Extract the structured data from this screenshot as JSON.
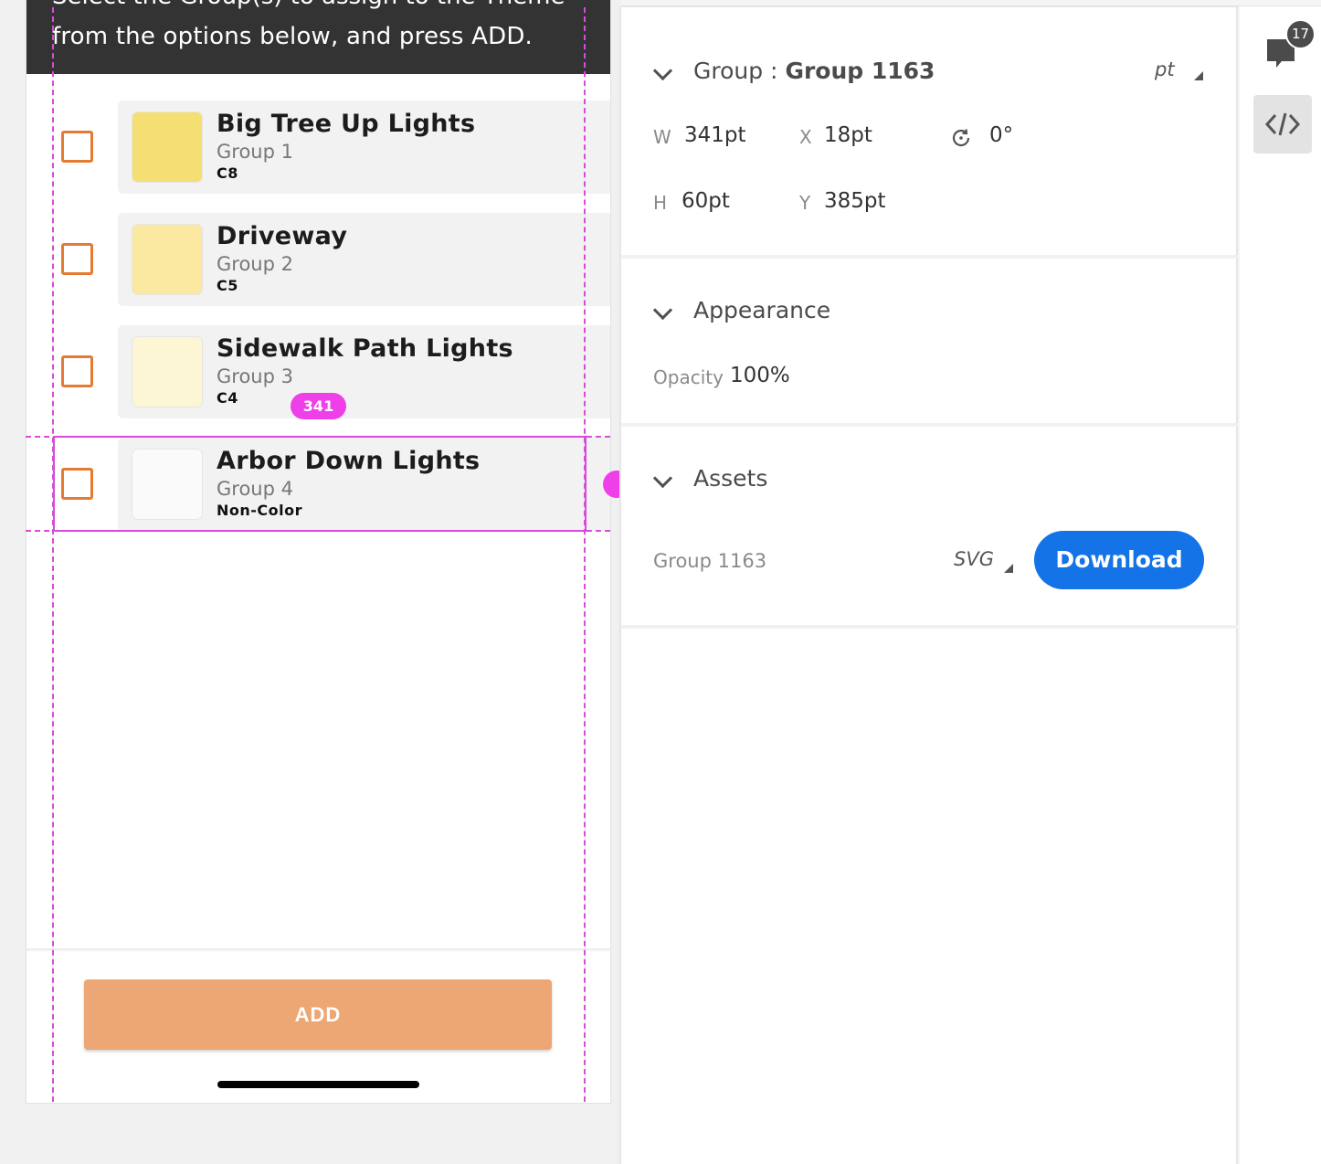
{
  "artboard": {
    "header_line1": "Select the Group(s) to assign to the Theme",
    "header_line2": "from the options below, and press ADD.",
    "groups": [
      {
        "title": "Big Tree Up Lights",
        "group": "Group 1",
        "code": "C8",
        "swatch": "#f5df72"
      },
      {
        "title": "Driveway",
        "group": "Group 2",
        "code": "C5",
        "swatch": "#fbe9a2"
      },
      {
        "title": "Sidewalk Path Lights",
        "group": "Group 3",
        "code": "C4",
        "swatch": "#fdf6d4"
      },
      {
        "title": "Arbor Down Lights",
        "group": "Group 4",
        "code": "Non-Color",
        "swatch": "#fafafa"
      }
    ],
    "add_label": "ADD",
    "measure_label": "341"
  },
  "inspector": {
    "group_prefix": "Group : ",
    "group_name": "Group 1163",
    "unit": "pt",
    "props": {
      "w_label": "W",
      "w_value": "341pt",
      "x_label": "X",
      "x_value": "18pt",
      "rotation_value": "0°",
      "h_label": "H",
      "h_value": "60pt",
      "y_label": "Y",
      "y_value": "385pt"
    },
    "appearance_title": "Appearance",
    "opacity_label": "Opacity",
    "opacity_value": "100%",
    "assets_title": "Assets",
    "asset_name": "Group 1163",
    "asset_format": "SVG",
    "download_label": "Download"
  },
  "toolbar": {
    "comment_count": "17",
    "code_icon": "code-icon"
  },
  "colors": {
    "header_bg": "#333333",
    "checkbox": "#e57b32",
    "add_button": "#eda774",
    "guide": "#d94bd8",
    "download": "#1473e6"
  }
}
